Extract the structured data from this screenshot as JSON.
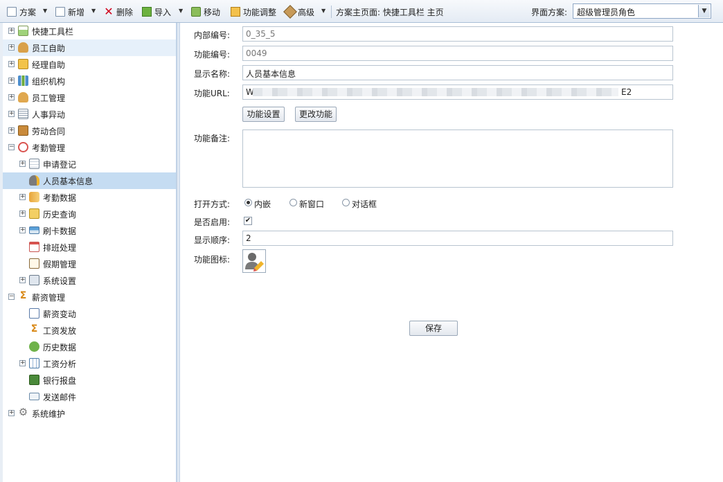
{
  "toolbar": {
    "scheme": "方案",
    "new": "新增",
    "delete": "删除",
    "import": "导入",
    "move": "移动",
    "function_adjust": "功能调整",
    "advanced": "高级",
    "home_info": "方案主页面: 快捷工具栏 主页",
    "ui_scheme_label": "界面方案:",
    "ui_scheme_value": "超级管理员角色"
  },
  "sidebar": {
    "items": [
      {
        "label": "快捷工具栏",
        "icon": "toolbar-icon"
      },
      {
        "label": "员工自助",
        "icon": "user-icon"
      },
      {
        "label": "经理自助",
        "icon": "manager-icon"
      },
      {
        "label": "组织机构",
        "icon": "org-chart-icon"
      },
      {
        "label": "员工管理",
        "icon": "users-icon"
      },
      {
        "label": "人事异动",
        "icon": "list-icon"
      },
      {
        "label": "劳动合同",
        "icon": "briefcase-icon"
      },
      {
        "label": "考勤管理",
        "icon": "clock-icon"
      },
      {
        "label": "申请登记",
        "icon": "form-icon"
      },
      {
        "label": "人员基本信息",
        "icon": "user-edit-icon"
      },
      {
        "label": "考勤数据",
        "icon": "database-icon"
      },
      {
        "label": "历史查询",
        "icon": "folder-search-icon"
      },
      {
        "label": "刷卡数据",
        "icon": "card-icon"
      },
      {
        "label": "排班处理",
        "icon": "calendar-icon"
      },
      {
        "label": "假期管理",
        "icon": "leave-icon"
      },
      {
        "label": "系统设置",
        "icon": "settings-search-icon"
      },
      {
        "label": "薪资管理",
        "icon": "sigma-icon"
      },
      {
        "label": "薪资变动",
        "icon": "chart-icon"
      },
      {
        "label": "工资发放",
        "icon": "sigma-icon"
      },
      {
        "label": "历史数据",
        "icon": "history-icon"
      },
      {
        "label": "工资分析",
        "icon": "table-icon"
      },
      {
        "label": "银行报盘",
        "icon": "bank-export-icon"
      },
      {
        "label": "发送邮件",
        "icon": "mail-icon"
      },
      {
        "label": "系统维护",
        "icon": "gear-icon"
      }
    ]
  },
  "form": {
    "internal_no_label": "内部编号:",
    "internal_no": "0_35_5",
    "func_no_label": "功能编号:",
    "func_no": "0049",
    "display_name_label": "显示名称:",
    "display_name": "人员基本信息",
    "url_label": "功能URL:",
    "url_prefix": "W",
    "url_suffix": "E2",
    "settings_button": "功能设置",
    "change_button": "更改功能",
    "remark_label": "功能备注:",
    "remark": "",
    "open_mode_label": "打开方式:",
    "open_modes": [
      "内嵌",
      "新窗口",
      "对话框"
    ],
    "open_mode_selected": "内嵌",
    "enabled_label": "是否启用:",
    "enabled": true,
    "order_label": "显示顺序:",
    "order": "2",
    "icon_label": "功能图标:",
    "save_button": "保存"
  }
}
